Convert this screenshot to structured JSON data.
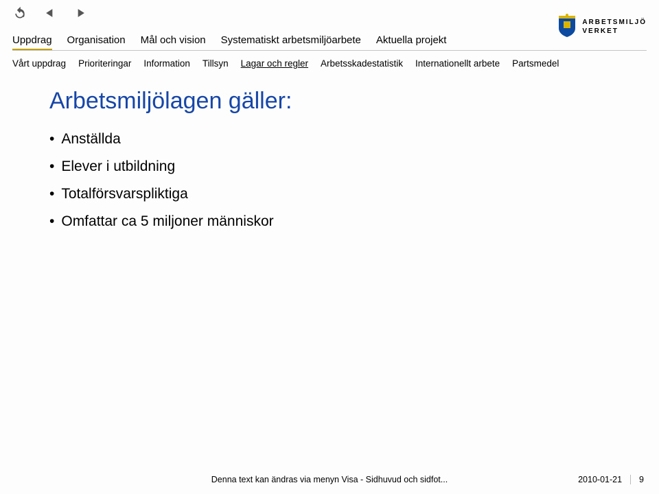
{
  "toolbar": {
    "undo": "undo",
    "prev": "prev",
    "next": "next"
  },
  "logo": {
    "line1": "ARBETSMILJÖ",
    "line2": "VERKET"
  },
  "nav1": {
    "items": [
      {
        "label": "Uppdrag"
      },
      {
        "label": "Organisation"
      },
      {
        "label": "Mål och vision"
      },
      {
        "label": "Systematiskt arbetsmiljöarbete"
      },
      {
        "label": "Aktuella projekt"
      }
    ]
  },
  "nav2": {
    "items": [
      {
        "label": "Vårt uppdrag"
      },
      {
        "label": "Prioriteringar"
      },
      {
        "label": "Information"
      },
      {
        "label": "Tillsyn"
      },
      {
        "label": "Lagar och regler"
      },
      {
        "label": "Arbetsskadestatistik"
      },
      {
        "label": "Internationellt arbete"
      },
      {
        "label": "Partsmedel"
      }
    ]
  },
  "content": {
    "heading": "Arbetsmiljölagen gäller:",
    "bullets": [
      "Anställda",
      "Elever i utbildning",
      "Totalförsvarspliktiga",
      "Omfattar ca 5 miljoner människor"
    ]
  },
  "footer": {
    "note": "Denna text kan ändras via menyn Visa - Sidhuvud och sidfot...",
    "date": "2010-01-21",
    "page": "9"
  }
}
